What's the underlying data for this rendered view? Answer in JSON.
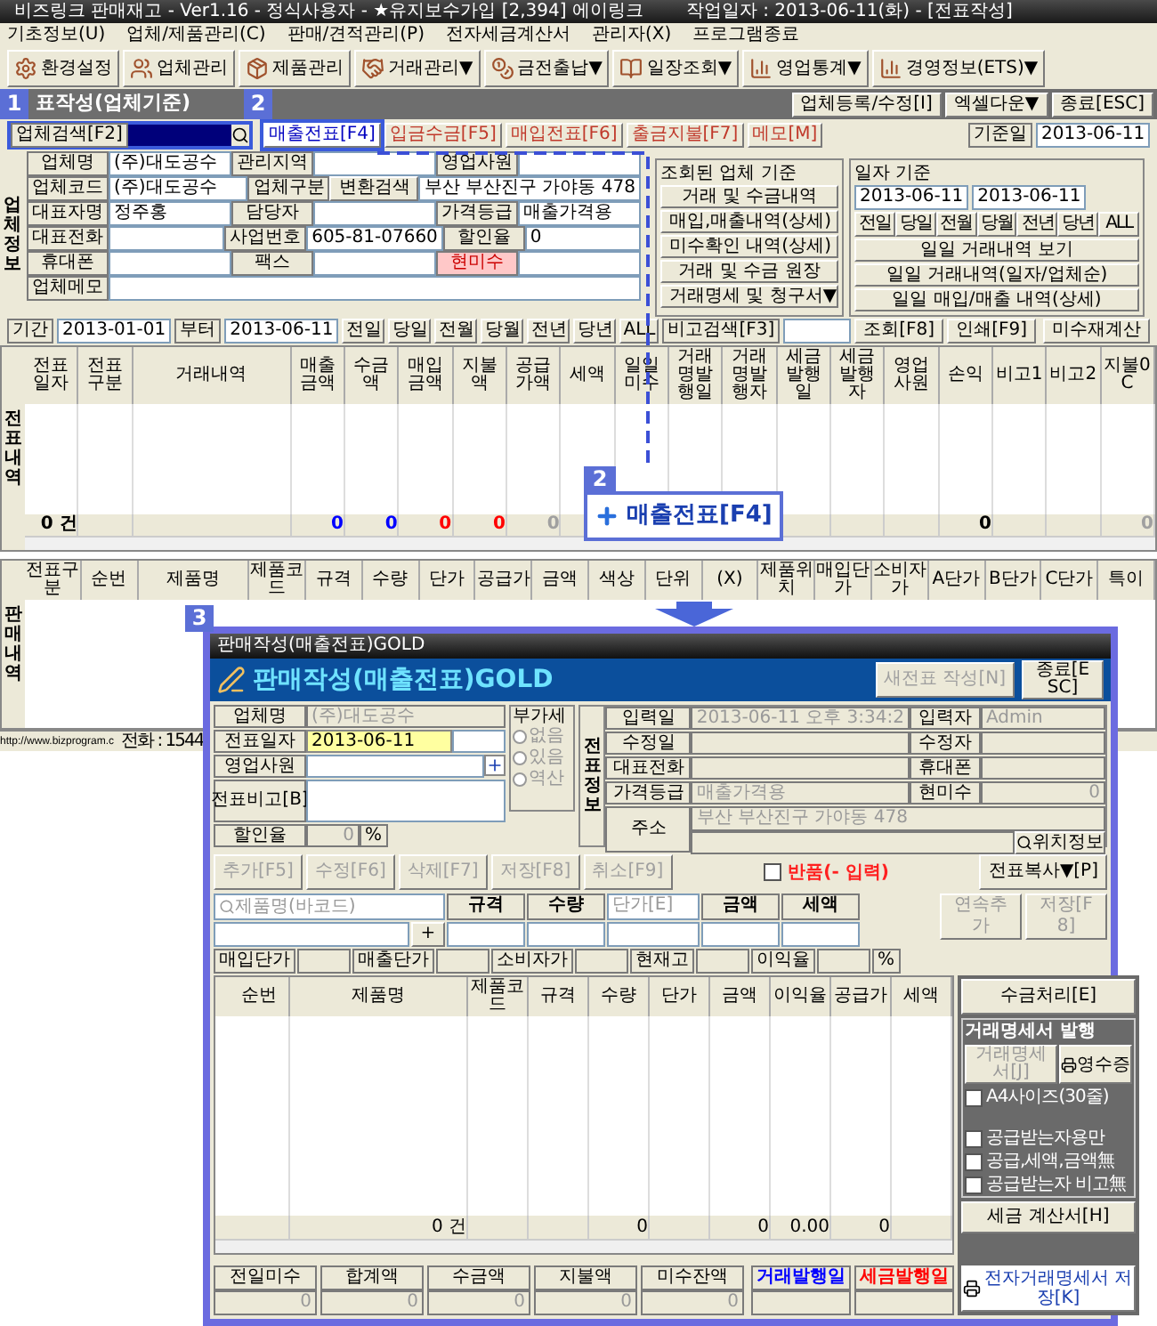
{
  "window": {
    "title": "비즈링크 판매재고 - Ver1.16 - 정식사용자 - ★유지보수가입 [2,394] 에이링크",
    "work_date": "작업일자 : 2013-06-11(화) - [전표작성]"
  },
  "menu": [
    "기초정보(U)",
    "업체/제품관리(C)",
    "판매/견적관리(P)",
    "전자세금계산서",
    "관리자(X)",
    "프로그램종료"
  ],
  "toolbar": [
    "환경설정",
    "업체관리",
    "제품관리",
    "거래관리▼",
    "금전출납▼",
    "일장조회▼",
    "영업통계▼",
    "경영정보(ETS)▼"
  ],
  "header": {
    "badge": "1",
    "title": "표작성(업체기준)",
    "badge2": "2",
    "buttons": [
      "업체등록/수정[I]",
      "엑셀다운▼",
      "종료[ESC]"
    ],
    "date_label": "기준일",
    "date": "2013-06-11"
  },
  "search": {
    "label": "업체검색[F2]"
  },
  "slip_tabs": [
    {
      "label": "매출전표[F4]",
      "selected": true
    },
    {
      "label": "입금수금[F5]",
      "selected": false
    },
    {
      "label": "매입전표[F6]",
      "selected": false
    },
    {
      "label": "출금지불[F7]",
      "selected": false
    },
    {
      "label": "메모[M]",
      "selected": false
    }
  ],
  "company_info": {
    "side_label": "업체정보",
    "rows": [
      [
        {
          "kind": "label",
          "text": "업체명"
        },
        {
          "kind": "value",
          "text": "(주)대도공수"
        },
        {
          "kind": "label",
          "text": "관리지역"
        },
        {
          "kind": "value"
        },
        {
          "kind": "label",
          "text": "영업사원"
        },
        {
          "kind": "value"
        }
      ],
      [
        {
          "kind": "label",
          "text": "업체코드"
        },
        {
          "kind": "value",
          "text": "(주)대도공수"
        },
        {
          "kind": "label",
          "text": "업체구분"
        },
        {
          "kind": "button",
          "text": "변환검색"
        },
        {
          "kind": "value",
          "text": "부산 부산진구 가야동 478"
        }
      ],
      [
        {
          "kind": "label",
          "text": "대표자명"
        },
        {
          "kind": "value",
          "text": "정주홍"
        },
        {
          "kind": "label",
          "text": "담당자"
        },
        {
          "kind": "value"
        },
        {
          "kind": "label",
          "text": "가격등급"
        },
        {
          "kind": "value",
          "text": "매출가격용"
        }
      ],
      [
        {
          "kind": "label",
          "text": "대표전화"
        },
        {
          "kind": "value"
        },
        {
          "kind": "label",
          "text": "사업번호"
        },
        {
          "kind": "value",
          "text": "605-81-07660"
        },
        {
          "kind": "label",
          "text": "할인율"
        },
        {
          "kind": "value",
          "text": "0"
        }
      ],
      [
        {
          "kind": "label",
          "text": "휴대폰"
        },
        {
          "kind": "value"
        },
        {
          "kind": "label",
          "text": "팩스"
        },
        {
          "kind": "value"
        },
        {
          "kind": "alert_label",
          "text": "현미수"
        },
        {
          "kind": "value"
        }
      ],
      [
        {
          "kind": "label",
          "text": "업체메모"
        },
        {
          "kind": "value"
        }
      ]
    ]
  },
  "company_query": {
    "title": "조회된 업체 기준",
    "buttons": [
      "거래 및 수금내역",
      "매입,매출내역(상세)",
      "미수확인 내역(상세)",
      "거래 및 수금 원장",
      "거래명세 및 청구서▼"
    ]
  },
  "date_query": {
    "title": "일자 기준",
    "from": "2013-06-11",
    "to": "2013-06-11",
    "quick": [
      "전일",
      "당일",
      "전월",
      "당월",
      "전년",
      "당년",
      "ALL"
    ],
    "buttons": [
      "일일 거래내역 보기",
      "일일 거래내역(일자/업체순)",
      "일일 매입/매출 내역(상세)"
    ]
  },
  "period": {
    "label": "기간",
    "from": "2013-01-01",
    "middle": "부터",
    "to": "2013-06-11",
    "quick": [
      "전일",
      "당일",
      "전월",
      "당월",
      "전년",
      "당년",
      "ALL"
    ],
    "memo_search": "비고검색[F3]",
    "query": "조회[F8]",
    "print": "인쇄[F9]",
    "recalc": "미수재계산"
  },
  "slip_grid": {
    "side_label": "전표내역",
    "columns": [
      {
        "label": "전표일자",
        "total": "0 건",
        "color": "#000000"
      },
      {
        "label": "전표구분"
      },
      {
        "label": "거래내역"
      },
      {
        "label": "매출금액",
        "total": "0",
        "color": "#0000ff"
      },
      {
        "label": "수금액",
        "total": "0",
        "color": "#0000ff"
      },
      {
        "label": "매입금액",
        "total": "0",
        "color": "#ff0000"
      },
      {
        "label": "지불액",
        "total": "0",
        "color": "#ff0000"
      },
      {
        "label": "공급가액",
        "total": "0",
        "color": "#a0a0a0"
      },
      {
        "label": "세액"
      },
      {
        "label": "일일미수"
      },
      {
        "label": "거래명발행일"
      },
      {
        "label": "거래명발행자"
      },
      {
        "label": "세금발행일"
      },
      {
        "label": "세금발행자"
      },
      {
        "label": "영업사원"
      },
      {
        "label": "손익",
        "total": "0",
        "color": "#000000"
      },
      {
        "label": "비고1"
      },
      {
        "label": "비고2"
      },
      {
        "label": "지불0C",
        "total": "0",
        "color": "#a0a0a0"
      }
    ]
  },
  "callout": {
    "badge": "2",
    "label": "매출전표[F4]"
  },
  "sales_grid": {
    "side_label": "판매내역",
    "columns": [
      "전표구분",
      "순번",
      "제품명",
      "제품코드",
      "규격",
      "수량",
      "단가",
      "공급가",
      "금액",
      "색상",
      "단위",
      "(X)",
      "제품위치",
      "매입단가",
      "소비자가",
      "A단가",
      "B단가",
      "C단가",
      "특이"
    ]
  },
  "status_bar": {
    "url": "http://www.bizprogram.c",
    "phone": "전화 : 1544"
  },
  "dialog": {
    "badge": "3",
    "title": "판매작성(매출전표)GOLD",
    "heading": "판매작성(매출전표)GOLD",
    "new_slip": {
      "label": "새전표 작성[N]",
      "disabled": true
    },
    "close": "종료[ESC]",
    "form": {
      "company_label": "업체명",
      "company": "(주)대도공수",
      "date_label": "전표일자",
      "date": "2013-06-11",
      "staff_label": "영업사원",
      "memo_label": "전표비고[B]",
      "discount_label": "할인율",
      "discount": "0",
      "percent": "%"
    },
    "vat": {
      "title": "부가세",
      "options": [
        "없음",
        "있음",
        "역산"
      ]
    },
    "slip_info": {
      "side_label": "전표정보",
      "rows": [
        [
          "입력일",
          "2013-06-11 오후 3:34:2",
          "입력자",
          "Admin"
        ],
        [
          "수정일",
          "",
          "수정자",
          ""
        ],
        [
          "대표전화",
          "",
          "휴대폰",
          ""
        ],
        [
          "가격등급",
          "매출가격용",
          "현미수",
          "0"
        ]
      ],
      "address_label": "주소",
      "address": "부산 부산진구 가야동 478",
      "locate": "위치정보"
    },
    "actions": [
      {
        "label": "추가[F5]",
        "disabled": true
      },
      {
        "label": "수정[F6]",
        "disabled": true
      },
      {
        "label": "삭제[F7]",
        "disabled": true
      },
      {
        "label": "저장[F8]",
        "disabled": true
      },
      {
        "label": "취소[F9]",
        "disabled": true
      }
    ],
    "return": {
      "label": "반품(- 입력)",
      "checked": false
    },
    "copy": "전표복사▼[P]",
    "entry": {
      "product": "제품명(바코드)",
      "plus": "+",
      "columns": [
        "규격",
        "수량"
      ],
      "price": "단가[E]",
      "columns2": [
        "금액",
        "세액"
      ],
      "add": "연속추가",
      "save": "저장[F8]"
    },
    "prices": [
      "매입단가",
      "매출단가",
      "소비자가",
      "현재고",
      "이익율"
    ],
    "prices_unit": "%",
    "grid": {
      "columns": [
        {
          "label": "순번"
        },
        {
          "label": "제품명",
          "total": "0 건"
        },
        {
          "label": "제품코드"
        },
        {
          "label": "규격"
        },
        {
          "label": "수량",
          "total": "0"
        },
        {
          "label": "단가"
        },
        {
          "label": "금액",
          "total": "0"
        },
        {
          "label": "이익율",
          "total": "0.00"
        },
        {
          "label": "공급가",
          "total": "0"
        },
        {
          "label": "세액"
        }
      ]
    },
    "side": {
      "collect": "수금처리[E]",
      "group": "거래명세서 발행",
      "statement": "거래명세서[J]",
      "receipt": "영수증",
      "options": [
        {
          "label": "A4사이즈(30줄)",
          "checked": false
        },
        {
          "label": "공급받는자용만",
          "checked": false
        },
        {
          "label": "공급,세액,금액無",
          "checked": false
        },
        {
          "label": "공급받는자 비고無",
          "checked": false
        }
      ],
      "tax": "세금 계산서[H]",
      "e_save": "전자거래명세서 저장[K]"
    },
    "summary": [
      {
        "label": "전일미수",
        "value": "0"
      },
      {
        "label": "합계액",
        "value": "0"
      },
      {
        "label": "수금액",
        "value": "0"
      },
      {
        "label": "지불액",
        "value": "0"
      },
      {
        "label": "미수잔액",
        "value": "0"
      }
    ],
    "issue": [
      {
        "label": "거래발행일",
        "color": "#0000ff"
      },
      {
        "label": "세금발행일",
        "color": "#ff0000"
      }
    ]
  }
}
